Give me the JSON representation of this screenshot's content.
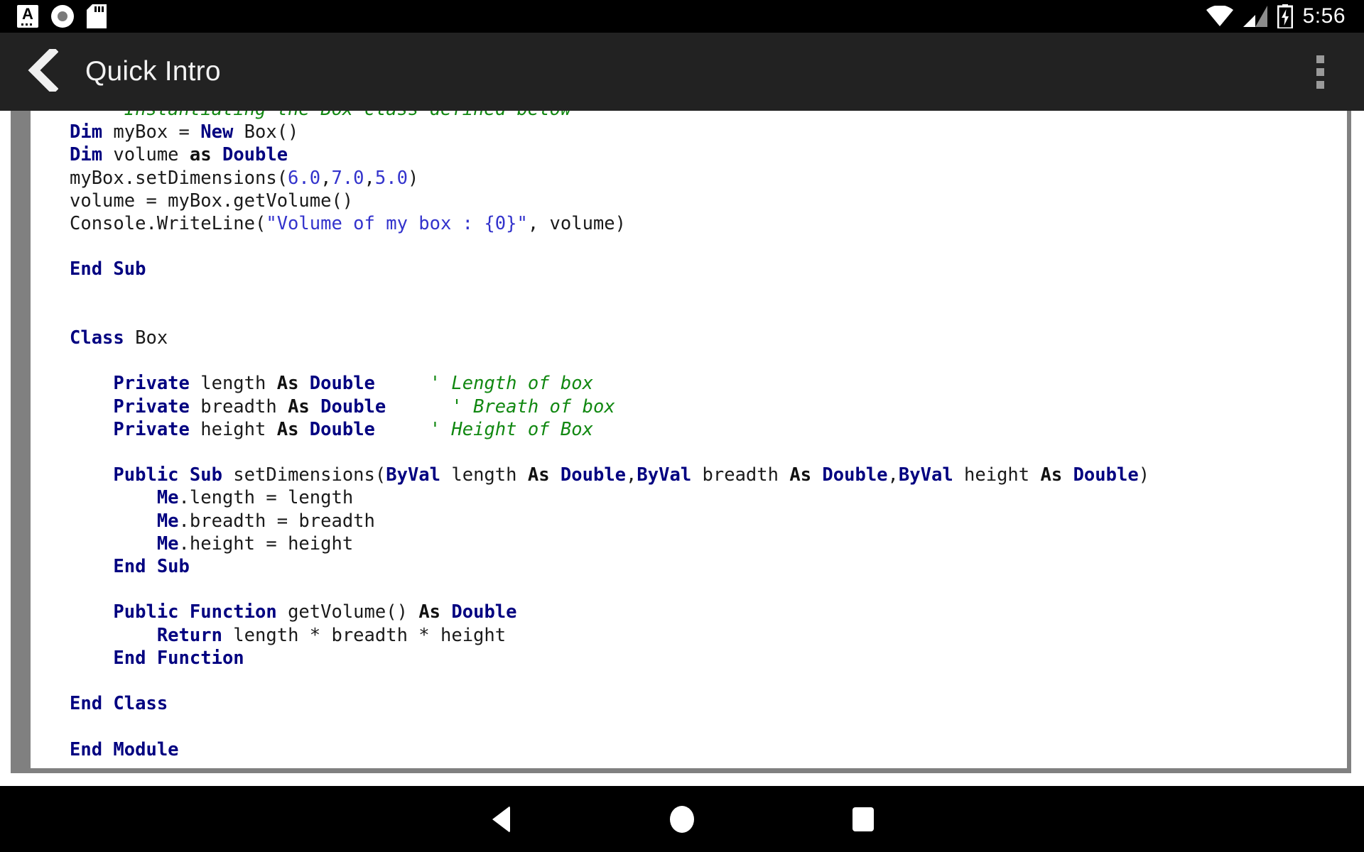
{
  "status_bar": {
    "time": "5:56",
    "icons_left": [
      "notification-a-icon",
      "screen-recorder-icon",
      "sd-card-icon"
    ],
    "icons_right": [
      "wifi-icon",
      "cellular-signal-icon",
      "battery-charging-icon"
    ],
    "background": "#000000"
  },
  "app_bar": {
    "back_label": "back-chevron",
    "title": "Quick Intro",
    "overflow_label": "more-options",
    "background": "#222222",
    "title_color": "#f2f2f2"
  },
  "code_view": {
    "language": "vb.net",
    "gutter_color": "#808080",
    "background": "#ffffff",
    "colors": {
      "keyword": "#000080",
      "comment": "#118811",
      "string": "#3333cc",
      "number": "#3333cc",
      "plain": "#1a1a1a"
    },
    "first_line_clipped": true,
    "lines": [
      {
        "indent": 0,
        "tokens": [
          {
            "t": "cmt",
            "v": "   ' Instantiating the Box class defined below"
          }
        ]
      },
      {
        "indent": 0,
        "tokens": [
          {
            "t": "kw",
            "v": "Dim"
          },
          {
            "t": "pl",
            "v": " myBox = "
          },
          {
            "t": "kw",
            "v": "New"
          },
          {
            "t": "pl",
            "v": " Box()"
          }
        ]
      },
      {
        "indent": 0,
        "tokens": [
          {
            "t": "kw",
            "v": "Dim"
          },
          {
            "t": "pl",
            "v": " volume "
          },
          {
            "t": "as",
            "v": "as"
          },
          {
            "t": "pl",
            "v": " "
          },
          {
            "t": "kw",
            "v": "Double"
          }
        ]
      },
      {
        "indent": 0,
        "tokens": [
          {
            "t": "pl",
            "v": "myBox.setDimensions("
          },
          {
            "t": "num",
            "v": "6.0"
          },
          {
            "t": "pl",
            "v": ","
          },
          {
            "t": "num",
            "v": "7.0"
          },
          {
            "t": "pl",
            "v": ","
          },
          {
            "t": "num",
            "v": "5.0"
          },
          {
            "t": "pl",
            "v": ")"
          }
        ]
      },
      {
        "indent": 0,
        "tokens": [
          {
            "t": "pl",
            "v": "volume = myBox.getVolume()"
          }
        ]
      },
      {
        "indent": 0,
        "tokens": [
          {
            "t": "pl",
            "v": "Console.WriteLine("
          },
          {
            "t": "str",
            "v": "\"Volume of my box : {0}\""
          },
          {
            "t": "pl",
            "v": ", volume)"
          }
        ]
      },
      {
        "indent": 0,
        "tokens": []
      },
      {
        "indent": 0,
        "tokens": [
          {
            "t": "kw",
            "v": "End Sub"
          }
        ]
      },
      {
        "indent": 0,
        "tokens": []
      },
      {
        "indent": 0,
        "tokens": []
      },
      {
        "indent": 0,
        "tokens": [
          {
            "t": "kw",
            "v": "Class"
          },
          {
            "t": "pl",
            "v": " Box"
          }
        ]
      },
      {
        "indent": 0,
        "tokens": []
      },
      {
        "indent": 0,
        "tokens": [
          {
            "t": "pl",
            "v": "    "
          },
          {
            "t": "kw",
            "v": "Private"
          },
          {
            "t": "pl",
            "v": " length "
          },
          {
            "t": "as",
            "v": "As"
          },
          {
            "t": "pl",
            "v": " "
          },
          {
            "t": "kw",
            "v": "Double"
          },
          {
            "t": "pl",
            "v": "     "
          },
          {
            "t": "cmt",
            "v": "' Length of box"
          }
        ]
      },
      {
        "indent": 0,
        "tokens": [
          {
            "t": "pl",
            "v": "    "
          },
          {
            "t": "kw",
            "v": "Private"
          },
          {
            "t": "pl",
            "v": " breadth "
          },
          {
            "t": "as",
            "v": "As"
          },
          {
            "t": "pl",
            "v": " "
          },
          {
            "t": "kw",
            "v": "Double"
          },
          {
            "t": "pl",
            "v": "     "
          },
          {
            "t": "cmt",
            "v": " ' Breath of box"
          }
        ]
      },
      {
        "indent": 0,
        "tokens": [
          {
            "t": "pl",
            "v": "    "
          },
          {
            "t": "kw",
            "v": "Private"
          },
          {
            "t": "pl",
            "v": " height "
          },
          {
            "t": "as",
            "v": "As"
          },
          {
            "t": "pl",
            "v": " "
          },
          {
            "t": "kw",
            "v": "Double"
          },
          {
            "t": "pl",
            "v": "     "
          },
          {
            "t": "cmt",
            "v": "' Height of Box"
          }
        ]
      },
      {
        "indent": 0,
        "tokens": []
      },
      {
        "indent": 0,
        "tokens": [
          {
            "t": "pl",
            "v": "    "
          },
          {
            "t": "kw",
            "v": "Public Sub"
          },
          {
            "t": "pl",
            "v": " setDimensions("
          },
          {
            "t": "kw",
            "v": "ByVal"
          },
          {
            "t": "pl",
            "v": " length "
          },
          {
            "t": "as",
            "v": "As"
          },
          {
            "t": "pl",
            "v": " "
          },
          {
            "t": "kw",
            "v": "Double"
          },
          {
            "t": "pl",
            "v": ","
          },
          {
            "t": "kw",
            "v": "ByVal"
          },
          {
            "t": "pl",
            "v": " breadth "
          },
          {
            "t": "as",
            "v": "As"
          },
          {
            "t": "pl",
            "v": " "
          },
          {
            "t": "kw",
            "v": "Double"
          },
          {
            "t": "pl",
            "v": ","
          },
          {
            "t": "kw",
            "v": "ByVal"
          },
          {
            "t": "pl",
            "v": " height "
          },
          {
            "t": "as",
            "v": "As"
          },
          {
            "t": "pl",
            "v": " "
          },
          {
            "t": "kw",
            "v": "Double"
          },
          {
            "t": "pl",
            "v": ")"
          }
        ]
      },
      {
        "indent": 0,
        "tokens": [
          {
            "t": "pl",
            "v": "        "
          },
          {
            "t": "kw",
            "v": "Me"
          },
          {
            "t": "pl",
            "v": ".length = length"
          }
        ]
      },
      {
        "indent": 0,
        "tokens": [
          {
            "t": "pl",
            "v": "        "
          },
          {
            "t": "kw",
            "v": "Me"
          },
          {
            "t": "pl",
            "v": ".breadth = breadth"
          }
        ]
      },
      {
        "indent": 0,
        "tokens": [
          {
            "t": "pl",
            "v": "        "
          },
          {
            "t": "kw",
            "v": "Me"
          },
          {
            "t": "pl",
            "v": ".height = height"
          }
        ]
      },
      {
        "indent": 0,
        "tokens": [
          {
            "t": "pl",
            "v": "    "
          },
          {
            "t": "kw",
            "v": "End Sub"
          }
        ]
      },
      {
        "indent": 0,
        "tokens": []
      },
      {
        "indent": 0,
        "tokens": [
          {
            "t": "pl",
            "v": "    "
          },
          {
            "t": "kw",
            "v": "Public Function"
          },
          {
            "t": "pl",
            "v": " getVolume() "
          },
          {
            "t": "as",
            "v": "As"
          },
          {
            "t": "pl",
            "v": " "
          },
          {
            "t": "kw",
            "v": "Double"
          }
        ]
      },
      {
        "indent": 0,
        "tokens": [
          {
            "t": "pl",
            "v": "        "
          },
          {
            "t": "kw",
            "v": "Return"
          },
          {
            "t": "pl",
            "v": " length * breadth * height"
          }
        ]
      },
      {
        "indent": 0,
        "tokens": [
          {
            "t": "pl",
            "v": "    "
          },
          {
            "t": "kw",
            "v": "End Function"
          }
        ]
      },
      {
        "indent": 0,
        "tokens": []
      },
      {
        "indent": 0,
        "tokens": [
          {
            "t": "kw",
            "v": "End Class"
          }
        ]
      },
      {
        "indent": 0,
        "tokens": []
      },
      {
        "indent": 0,
        "tokens": [
          {
            "t": "pl",
            "v": "-"
          },
          {
            "t": "kw",
            "v": "End Module"
          }
        ]
      }
    ]
  },
  "nav_bar": {
    "background": "#000000",
    "buttons": [
      {
        "name": "back",
        "glyph": "triangle-left"
      },
      {
        "name": "home",
        "glyph": "circle"
      },
      {
        "name": "recents",
        "glyph": "square"
      }
    ]
  }
}
